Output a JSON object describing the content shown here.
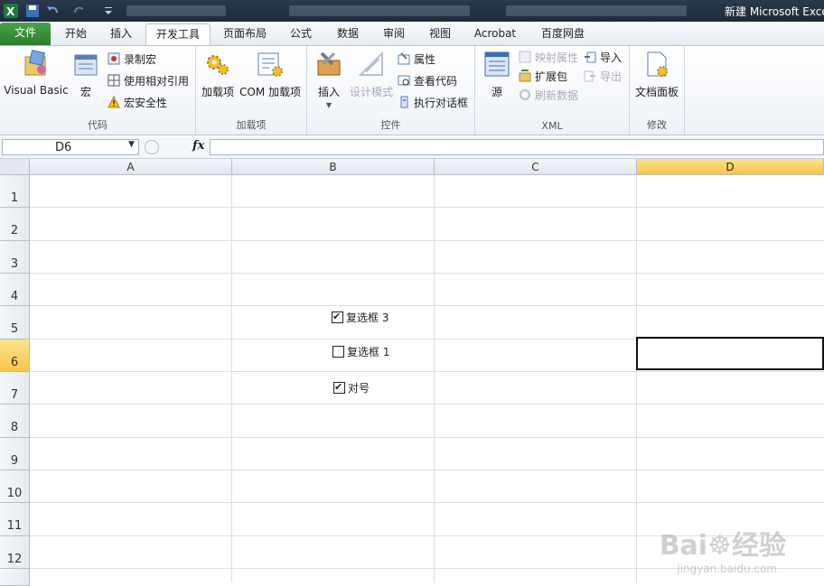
{
  "app": {
    "title": "新建 Microsoft Exce"
  },
  "tabs": [
    {
      "label": "文件"
    },
    {
      "label": "开始"
    },
    {
      "label": "插入"
    },
    {
      "label": "开发工具"
    },
    {
      "label": "页面布局"
    },
    {
      "label": "公式"
    },
    {
      "label": "数据"
    },
    {
      "label": "审阅"
    },
    {
      "label": "视图"
    },
    {
      "label": "Acrobat"
    },
    {
      "label": "百度网盘"
    }
  ],
  "ribbon": {
    "code": {
      "label": "代码",
      "visual_basic": "Visual Basic",
      "macros": "宏",
      "record_macro": "录制宏",
      "relative_ref": "使用相对引用",
      "macro_security": "宏安全性"
    },
    "addins": {
      "label": "加载项",
      "addins": "加载项",
      "com_addins": "COM 加载项"
    },
    "controls": {
      "label": "控件",
      "insert": "插入",
      "design_mode": "设计模式",
      "properties": "属性",
      "view_code": "查看代码",
      "run_dialog": "执行对话框"
    },
    "xml": {
      "label": "XML",
      "source": "源",
      "map_properties": "映射属性",
      "expansion_packs": "扩展包",
      "refresh_data": "刷新数据",
      "import": "导入",
      "export": "导出"
    },
    "modify": {
      "label": "修改",
      "doc_panel": "文档面板"
    }
  },
  "formula_bar": {
    "name_box": "D6",
    "fx": "fx",
    "value": ""
  },
  "grid": {
    "columns": [
      "A",
      "B",
      "C",
      "D"
    ],
    "rows": [
      "1",
      "2",
      "3",
      "4",
      "5",
      "6",
      "7",
      "8",
      "9",
      "10",
      "11",
      "12"
    ],
    "selected_cell": "D6"
  },
  "checkboxes": [
    {
      "label": "复选框 3",
      "checked": true
    },
    {
      "label": "复选框 1",
      "checked": false
    },
    {
      "label": "对号",
      "checked": true
    }
  ],
  "watermark": {
    "brand": "Bai",
    "brand2": "经验",
    "url": "jingyan.baidu.com"
  },
  "colors": {
    "file_tab": "#2b7f2b",
    "selected_header": "#f6c64c",
    "ribbon_bg": "#eef2f8"
  }
}
